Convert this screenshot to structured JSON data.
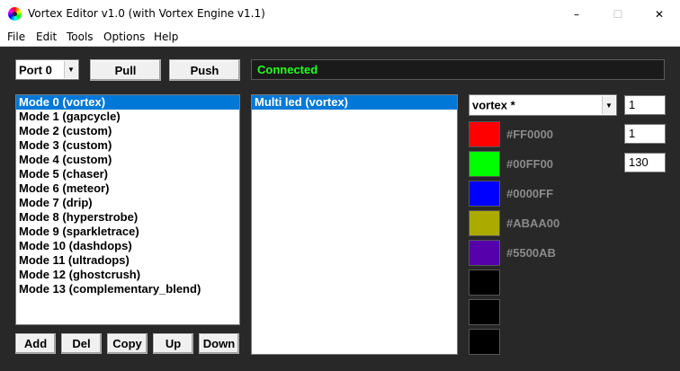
{
  "window": {
    "title": "Vortex Editor v1.0 (with Vortex Engine v1.1)",
    "controls": {
      "minimize": "–",
      "maximize": "☐",
      "close": "✕"
    }
  },
  "menubar": [
    "File",
    "Edit",
    "Tools",
    "Options",
    "Help"
  ],
  "toolbar": {
    "port_select": "Port 0",
    "pull_label": "Pull",
    "push_label": "Push",
    "status_text": "Connected",
    "status_color": "#22ff22"
  },
  "modes": {
    "selected_index": 0,
    "items": [
      "Mode 0 (vortex)",
      "Mode 1 (gapcycle)",
      "Mode 2 (custom)",
      "Mode 3 (custom)",
      "Mode 4 (custom)",
      "Mode 5 (chaser)",
      "Mode 6 (meteor)",
      "Mode 7 (drip)",
      "Mode 8 (hyperstrobe)",
      "Mode 9 (sparkletrace)",
      "Mode 10 (dashdops)",
      "Mode 11 (ultradops)",
      "Mode 12 (ghostcrush)",
      "Mode 13 (complementary_blend)"
    ]
  },
  "mode_buttons": {
    "add": "Add",
    "del": "Del",
    "copy": "Copy",
    "up": "Up",
    "down": "Down"
  },
  "leds": {
    "selected_index": 0,
    "items": [
      "Multi led (vortex)"
    ]
  },
  "pattern": {
    "select": "vortex *",
    "params": [
      "1",
      "1",
      "130"
    ]
  },
  "colors": [
    {
      "hex": "#FF0000",
      "label": "#FF0000"
    },
    {
      "hex": "#00FF00",
      "label": "#00FF00"
    },
    {
      "hex": "#0000FF",
      "label": "#0000FF"
    },
    {
      "hex": "#ABAA00",
      "label": "#ABAA00"
    },
    {
      "hex": "#5500AB",
      "label": "#5500AB"
    },
    {
      "hex": "#000000",
      "label": ""
    },
    {
      "hex": "#000000",
      "label": ""
    },
    {
      "hex": "#000000",
      "label": ""
    }
  ]
}
